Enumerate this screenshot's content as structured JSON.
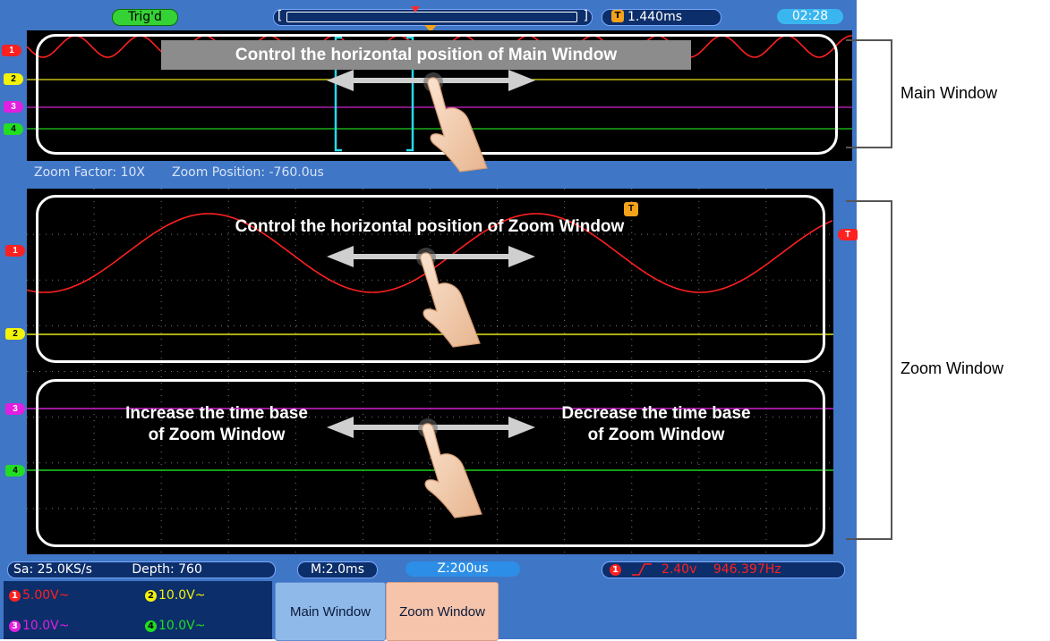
{
  "status": {
    "trigger_state": "Trig'd",
    "memory_left": "[",
    "memory_right": "]",
    "trigger_position": "1.440ms",
    "clock": "02:28"
  },
  "main_window": {
    "zoom_factor": "Zoom Factor: 10X",
    "zoom_position": "Zoom Position: -760.0us",
    "annotation": "Control the horizontal position of Main Window"
  },
  "zoom_window": {
    "annotation_top": "Control the horizontal position of Zoom Window",
    "annotation_left": "Increase the time base\nof Zoom Window",
    "annotation_right": "Decrease the time base\nof Zoom Window"
  },
  "channel_markers": [
    "1",
    "2",
    "3",
    "4"
  ],
  "trigger_marker": "T",
  "bottom": {
    "sample_rate": "Sa: 25.0KS/s",
    "depth": "Depth: 760",
    "main_timebase": "M:2.0ms",
    "zoom_timebase": "Z:200us",
    "trigger_channel": "1",
    "trigger_level": "2.40v",
    "frequency": "946.397Hz"
  },
  "channels": [
    {
      "num": "1",
      "value": "5.00V~",
      "color": "#ff2020"
    },
    {
      "num": "2",
      "value": "10.0V~",
      "color": "#f2f20a"
    },
    {
      "num": "3",
      "value": "10.0V~",
      "color": "#e020e0"
    },
    {
      "num": "4",
      "value": "10.0V~",
      "color": "#22dd22"
    }
  ],
  "menu": {
    "main_window": "Main Window",
    "zoom_window": "Zoom Window"
  },
  "labels": {
    "main_window": "Main Window",
    "zoom_window": "Zoom Window"
  },
  "colors": {
    "ch1": "#ff2020",
    "ch2": "#f2f20a",
    "ch3": "#e020e0",
    "ch4": "#22dd22",
    "bezel": "#3f76c6"
  }
}
